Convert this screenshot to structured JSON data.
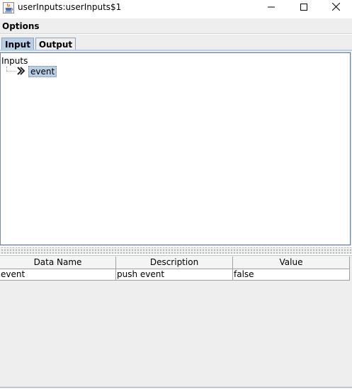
{
  "window": {
    "title": "userInputs:userInputs$1",
    "icon": "java-cup-icon",
    "controls": [
      "minimize-icon",
      "maximize-icon",
      "close-icon"
    ]
  },
  "menubar": {
    "items": [
      "Options"
    ]
  },
  "tabs": [
    {
      "label": "Input",
      "selected": true
    },
    {
      "label": "Output",
      "selected": false
    }
  ],
  "tree": {
    "root_label": "Inputs",
    "nodes": [
      {
        "label": "event",
        "icon": "double-chevron-right-icon",
        "selected": true
      }
    ]
  },
  "table": {
    "columns": [
      "Data Name",
      "Description",
      "Value"
    ],
    "rows": [
      [
        "event",
        "push event",
        "false"
      ]
    ]
  },
  "colors": {
    "selection": "#b8cfe5",
    "background": "#eeeeee"
  }
}
